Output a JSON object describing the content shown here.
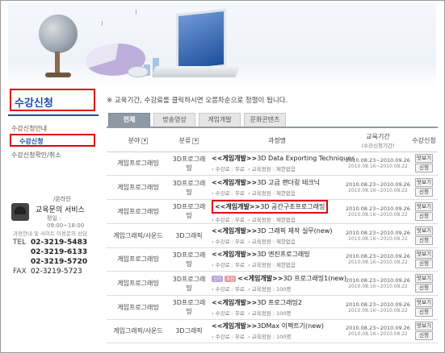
{
  "sidebar": {
    "title": "수강신청",
    "items": [
      {
        "label": "수강신청안내",
        "active": false
      },
      {
        "label": "수강신청",
        "active": true
      },
      {
        "label": "수강신청확인/취소",
        "active": false
      }
    ],
    "contact": {
      "online": "/온라인",
      "service": "교육문의 서비스",
      "hours": "평일 : 09:00~18:00",
      "notice": "과정안내 및 사이트 이용문의 상담",
      "phones": [
        {
          "label": "TEL",
          "number": "02-3219-5483"
        },
        {
          "label": "",
          "number": "02-3219-6133"
        },
        {
          "label": "",
          "number": "02-3219-5720"
        },
        {
          "label": "FAX",
          "number": "02-3219-5723"
        }
      ]
    }
  },
  "instruction": "※ 교육기간, 수강료를 클릭하시면 오름차순으로 정렬이 됩니다.",
  "tabs": [
    {
      "label": "전체",
      "active": true
    },
    {
      "label": "방송영상",
      "active": false
    },
    {
      "label": "게임개발",
      "active": false
    },
    {
      "label": "문화콘텐츠",
      "active": false
    }
  ],
  "table": {
    "headers": {
      "field": "분야",
      "category": "분류",
      "course": "과정명",
      "period": "교육기간",
      "period_sub": "(수강신청기간)",
      "apply": "수강신청"
    },
    "btn_preview": "맛보기",
    "btn_apply": "신청",
    "rows": [
      {
        "field": "게임프로그래밍",
        "category": "3D프로그래밍",
        "prefix": "<<게임개발>>",
        "title": "3D Data Exporting Techniques",
        "fee": "수강료 : 무료",
        "capacity": "교육정원 : 제한없음",
        "badges": [],
        "period": "2010.08.23~2010.09.26",
        "apply_period": "2010.08.16~2010.08.22",
        "highlight": false
      },
      {
        "field": "게임프로그래밍",
        "category": "3D프로그래밍",
        "prefix": "<<게임개발>>",
        "title": "3D 고급 랜더링 테크닉",
        "fee": "수강료 : 무료",
        "capacity": "교육정원 : 제한없음",
        "badges": [],
        "period": "2010.08.23~2010.09.26",
        "apply_period": "2010.08.16~2010.08.22",
        "highlight": false
      },
      {
        "field": "게임프로그래밍",
        "category": "3D프로그래밍",
        "prefix": "<<게임개발>>",
        "title": "3D 공간구조프로그래밍",
        "fee": "수강료 : 무료",
        "capacity": "교육정원 : 제한없음",
        "badges": [],
        "period": "2010.08.23~2010.09.26",
        "apply_period": "2010.08.16~2010.08.22",
        "highlight": true
      },
      {
        "field": "게임그래픽/사운드",
        "category": "3D그래픽",
        "prefix": "<<게임개발>>",
        "title": "3D 그래픽 제작 실무(new)",
        "fee": "수강료 : 무료",
        "capacity": "교육정원 : 제한없음",
        "badges": [],
        "period": "2010.08.23~2010.09.26",
        "apply_period": "2010.08.16~2010.08.22",
        "highlight": false
      },
      {
        "field": "게임프로그래밍",
        "category": "3D프로그래밍",
        "prefix": "<<게임개발>>",
        "title": "3D 엔진프로그래밍",
        "fee": "수강료 : 무료",
        "capacity": "교육정원 : 제한없음",
        "badges": [],
        "period": "2010.08.23~2010.09.26",
        "apply_period": "2010.08.16~2010.08.22",
        "highlight": false
      },
      {
        "field": "게임프로그래밍",
        "category": "3D프로그래밍",
        "prefix": "<<게임개발>>",
        "title": "3D 프로그래밍1(new)",
        "fee": "수강료 : 무료",
        "capacity": "교육정원 : 100명",
        "badges": [
          "인기",
          "추천"
        ],
        "period": "2010.08.23~2010.09.26",
        "apply_period": "2010.08.16~2010.08.22",
        "highlight": false
      },
      {
        "field": "게임프로그래밍",
        "category": "3D프로그래밍",
        "prefix": "<<게임개발>>",
        "title": "3D 프로그래밍2",
        "fee": "수강료 : 무료",
        "capacity": "교육정원 : 100명",
        "badges": [],
        "period": "2010.08.23~2010.09.26",
        "apply_period": "2010.08.16~2010.08.22",
        "highlight": false
      },
      {
        "field": "게임그래픽/사운드",
        "category": "3D그래픽",
        "prefix": "<<게임개발>>",
        "title": "3DMax 이펙트기(new)",
        "fee": "수강료 : 무료",
        "capacity": "교육정원 : 100명",
        "badges": [],
        "period": "2010.08.23~2010.09.26",
        "apply_period": "2010.08.16~2010.08.22",
        "highlight": false
      }
    ]
  }
}
